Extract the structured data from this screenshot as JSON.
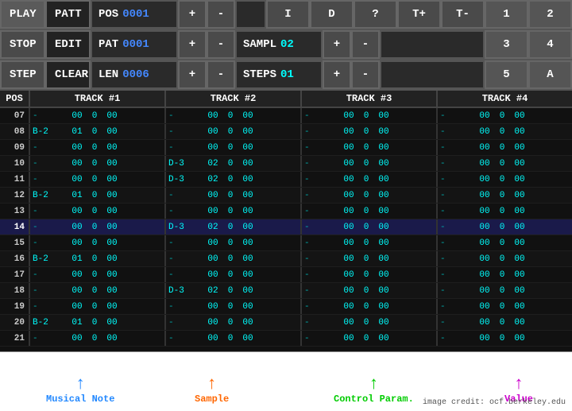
{
  "toolbar": {
    "row1": {
      "play_label": "PLAY",
      "patt_label": "PATT",
      "pos_label": "POS",
      "pos_value": "0001",
      "plus": "+",
      "minus": "-",
      "btn_i": "I",
      "btn_d": "D",
      "btn_q": "?",
      "btn_tplus": "T+",
      "btn_tminus": "T-",
      "btn_1": "1",
      "btn_2": "2"
    },
    "row2": {
      "stop_label": "STOP",
      "edit_label": "EDIT",
      "pat_label": "PAT",
      "pat_value": "0001",
      "plus": "+",
      "minus": "-",
      "sampl_label": "SAMPL",
      "sampl_value": "02",
      "splus": "+",
      "sminus": "-",
      "btn_3": "3",
      "btn_4": "4"
    },
    "row3": {
      "step_label": "STEP",
      "clear_label": "CLEAR",
      "len_label": "LEN",
      "len_value": "0006",
      "plus": "+",
      "minus": "-",
      "steps_label": "STEPS",
      "steps_value": "01",
      "stplus": "+",
      "stminus": "-",
      "btn_5": "5",
      "btn_a": "A"
    }
  },
  "seq": {
    "headers": [
      "POS",
      "TRACK #1",
      "TRACK #2",
      "TRACK #3",
      "TRACK #4"
    ],
    "rows": [
      {
        "pos": "07",
        "t1n": "-",
        "t1s": "00",
        "t1c": "0",
        "t1v": "00",
        "t2n": "-",
        "t2s": "00",
        "t2c": "0",
        "t2v": "00",
        "t3n": "-",
        "t3s": "00",
        "t3c": "0",
        "t3v": "00",
        "t4n": "-",
        "t4s": "00",
        "t4c": "0",
        "t4v": "00"
      },
      {
        "pos": "08",
        "t1n": "B-2",
        "t1s": "01",
        "t1c": "0",
        "t1v": "00",
        "t2n": "-",
        "t2s": "00",
        "t2c": "0",
        "t2v": "00",
        "t3n": "-",
        "t3s": "00",
        "t3c": "0",
        "t3v": "00",
        "t4n": "-",
        "t4s": "00",
        "t4c": "0",
        "t4v": "00"
      },
      {
        "pos": "09",
        "t1n": "-",
        "t1s": "00",
        "t1c": "0",
        "t1v": "00",
        "t2n": "-",
        "t2s": "00",
        "t2c": "0",
        "t2v": "00",
        "t3n": "-",
        "t3s": "00",
        "t3c": "0",
        "t3v": "00",
        "t4n": "-",
        "t4s": "00",
        "t4c": "0",
        "t4v": "00"
      },
      {
        "pos": "10",
        "t1n": "-",
        "t1s": "00",
        "t1c": "0",
        "t1v": "00",
        "t2n": "D-3",
        "t2s": "02",
        "t2c": "0",
        "t2v": "00",
        "t3n": "-",
        "t3s": "00",
        "t3c": "0",
        "t3v": "00",
        "t4n": "-",
        "t4s": "00",
        "t4c": "0",
        "t4v": "00"
      },
      {
        "pos": "11",
        "t1n": "-",
        "t1s": "00",
        "t1c": "0",
        "t1v": "00",
        "t2n": "D-3",
        "t2s": "02",
        "t2c": "0",
        "t2v": "00",
        "t3n": "-",
        "t3s": "00",
        "t3c": "0",
        "t3v": "00",
        "t4n": "-",
        "t4s": "00",
        "t4c": "0",
        "t4v": "00"
      },
      {
        "pos": "12",
        "t1n": "B-2",
        "t1s": "01",
        "t1c": "0",
        "t1v": "00",
        "t2n": "-",
        "t2s": "00",
        "t2c": "0",
        "t2v": "00",
        "t3n": "-",
        "t3s": "00",
        "t3c": "0",
        "t3v": "00",
        "t4n": "-",
        "t4s": "00",
        "t4c": "0",
        "t4v": "00"
      },
      {
        "pos": "13",
        "t1n": "-",
        "t1s": "00",
        "t1c": "0",
        "t1v": "00",
        "t2n": "-",
        "t2s": "00",
        "t2c": "0",
        "t2v": "00",
        "t3n": "-",
        "t3s": "00",
        "t3c": "0",
        "t3v": "00",
        "t4n": "-",
        "t4s": "00",
        "t4c": "0",
        "t4v": "00"
      },
      {
        "pos": "14",
        "t1n": "-",
        "t1s": "00",
        "t1c": "0",
        "t1v": "00",
        "t2n": "D-3",
        "t2s": "02",
        "t2c": "0",
        "t2v": "00",
        "t3n": "-",
        "t3s": "00",
        "t3c": "0",
        "t3v": "00",
        "t4n": "-",
        "t4s": "00",
        "t4c": "0",
        "t4v": "00",
        "active": true
      },
      {
        "pos": "15",
        "t1n": "-",
        "t1s": "00",
        "t1c": "0",
        "t1v": "00",
        "t2n": "-",
        "t2s": "00",
        "t2c": "0",
        "t2v": "00",
        "t3n": "-",
        "t3s": "00",
        "t3c": "0",
        "t3v": "00",
        "t4n": "-",
        "t4s": "00",
        "t4c": "0",
        "t4v": "00"
      },
      {
        "pos": "16",
        "t1n": "B-2",
        "t1s": "01",
        "t1c": "0",
        "t1v": "00",
        "t2n": "-",
        "t2s": "00",
        "t2c": "0",
        "t2v": "00",
        "t3n": "-",
        "t3s": "00",
        "t3c": "0",
        "t3v": "00",
        "t4n": "-",
        "t4s": "00",
        "t4c": "0",
        "t4v": "00"
      },
      {
        "pos": "17",
        "t1n": "-",
        "t1s": "00",
        "t1c": "0",
        "t1v": "00",
        "t2n": "-",
        "t2s": "00",
        "t2c": "0",
        "t2v": "00",
        "t3n": "-",
        "t3s": "00",
        "t3c": "0",
        "t3v": "00",
        "t4n": "-",
        "t4s": "00",
        "t4c": "0",
        "t4v": "00"
      },
      {
        "pos": "18",
        "t1n": "-",
        "t1s": "00",
        "t1c": "0",
        "t1v": "00",
        "t2n": "D-3",
        "t2s": "02",
        "t2c": "0",
        "t2v": "00",
        "t3n": "-",
        "t3s": "00",
        "t3c": "0",
        "t3v": "00",
        "t4n": "-",
        "t4s": "00",
        "t4c": "0",
        "t4v": "00"
      },
      {
        "pos": "19",
        "t1n": "-",
        "t1s": "00",
        "t1c": "0",
        "t1v": "00",
        "t2n": "-",
        "t2s": "00",
        "t2c": "0",
        "t2v": "00",
        "t3n": "-",
        "t3s": "00",
        "t3c": "0",
        "t3v": "00",
        "t4n": "-",
        "t4s": "00",
        "t4c": "0",
        "t4v": "00"
      },
      {
        "pos": "20",
        "t1n": "B-2",
        "t1s": "01",
        "t1c": "0",
        "t1v": "00",
        "t2n": "-",
        "t2s": "00",
        "t2c": "0",
        "t2v": "00",
        "t3n": "-",
        "t3s": "00",
        "t3c": "0",
        "t3v": "00",
        "t4n": "-",
        "t4s": "00",
        "t4c": "0",
        "t4v": "00"
      },
      {
        "pos": "21",
        "t1n": "-",
        "t1s": "00",
        "t1c": "0",
        "t1v": "00",
        "t2n": "-",
        "t2s": "00",
        "t2c": "0",
        "t2v": "00",
        "t3n": "-",
        "t3s": "00",
        "t3c": "0",
        "t3v": "00",
        "t4n": "-",
        "t4s": "00",
        "t4c": "0",
        "t4v": "00"
      }
    ]
  },
  "annotations": [
    {
      "label": "Musical  Note",
      "color": "#2288ff",
      "left": "58"
    },
    {
      "label": "Sample",
      "color": "#ff6600",
      "left": "245"
    },
    {
      "label": "Control Param.",
      "color": "#00cc00",
      "left": "430"
    },
    {
      "label": "Value",
      "color": "#cc00cc",
      "left": "640"
    }
  ],
  "credit": "image credit: ocf.berkeley.edu"
}
